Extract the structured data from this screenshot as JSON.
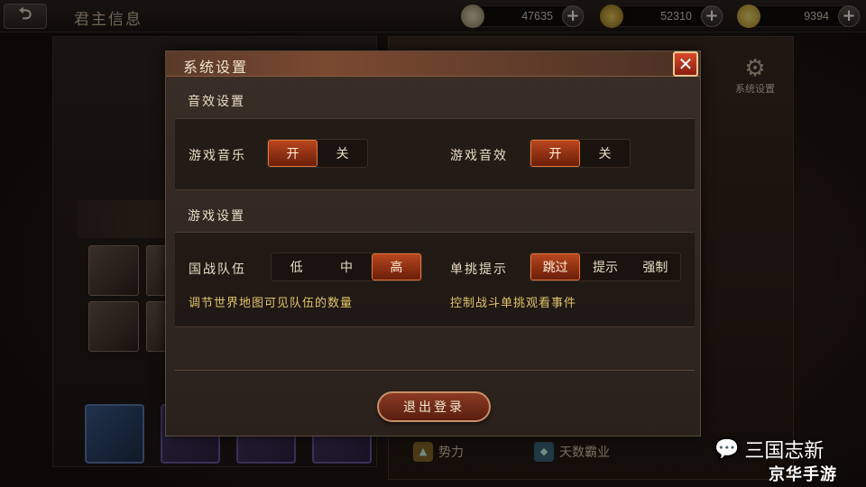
{
  "topbar": {
    "back_label": "⮌",
    "title": "君主信息",
    "resources": [
      {
        "icon": "silver-icon",
        "value": "47635",
        "plus": "+"
      },
      {
        "icon": "coin-icon",
        "value": "52310",
        "plus": "+"
      },
      {
        "icon": "gold-ingot-icon",
        "value": "9394",
        "plus": "+"
      }
    ]
  },
  "background": {
    "system_shortcut_label": "系统设置",
    "tabs": [
      {
        "label": "势力"
      },
      {
        "label": "天数霸业"
      }
    ]
  },
  "modal": {
    "title": "系统设置",
    "close": "✕",
    "audio_section": {
      "label": "音效设置",
      "music": {
        "label": "游戏音乐",
        "options": [
          "开",
          "关"
        ],
        "selected": "开"
      },
      "sfx": {
        "label": "游戏音效",
        "options": [
          "开",
          "关"
        ],
        "selected": "开"
      }
    },
    "game_section": {
      "label": "游戏设置",
      "troops": {
        "label": "国战队伍",
        "options": [
          "低",
          "中",
          "高"
        ],
        "selected": "高",
        "desc": "调节世界地图可见队伍的数量"
      },
      "duel": {
        "label": "单挑提示",
        "options": [
          "跳过",
          "提示",
          "强制"
        ],
        "selected": "跳过",
        "desc": "控制战斗单挑观看事件"
      }
    },
    "logout_label": "退出登录"
  },
  "watermark": {
    "line1": "三国志新",
    "line2": "京华手游"
  },
  "colors": {
    "accent_on": "#b8461e",
    "desc_text": "#e0c46a",
    "close_red": "#d84a2a"
  }
}
